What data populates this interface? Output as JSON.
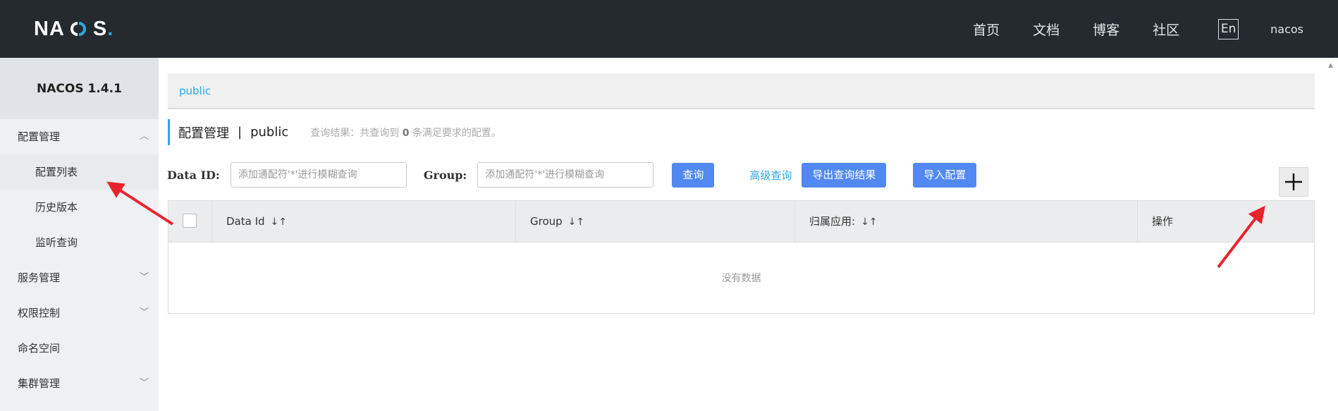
{
  "header": {
    "logo_text": "NACOS.",
    "nav": [
      "首页",
      "文档",
      "博客",
      "社区"
    ],
    "lang": "En",
    "user": "nacos"
  },
  "sidebar": {
    "version": "NACOS 1.4.1",
    "items": [
      {
        "label": "配置管理",
        "icon": "chevron-up-icon"
      },
      {
        "label": "配置列表"
      },
      {
        "label": "历史版本"
      },
      {
        "label": "监听查询"
      },
      {
        "label": "服务管理",
        "icon": "chevron-down-icon"
      },
      {
        "label": "权限控制",
        "icon": "chevron-down-icon"
      },
      {
        "label": "命名空间"
      },
      {
        "label": "集群管理",
        "icon": "chevron-down-icon"
      }
    ]
  },
  "main": {
    "breadcrumb": "public",
    "title": "配置管理",
    "separator": "|",
    "namespace": "public",
    "summary_prefix": "查询结果：共查询到",
    "summary_count": "0",
    "summary_suffix": "条满足要求的配置。",
    "filters": {
      "dataid_label": "Data ID:",
      "dataid_placeholder": "添加通配符'*'进行模糊查询",
      "group_label": "Group:",
      "group_placeholder": "添加通配符'*'进行模糊查询",
      "query_button": "查询",
      "advanced_link": "高级查询",
      "export_button": "导出查询结果",
      "import_button": "导入配置"
    },
    "table": {
      "columns": [
        "Data Id",
        "Group",
        "归属应用:",
        "操作"
      ],
      "empty_text": "没有数据"
    }
  },
  "colors": {
    "topbar": "#252a2f",
    "accent": "#2ea7e0",
    "primary_button": "#5188f2",
    "annotation_arrow": "#e8232d"
  }
}
